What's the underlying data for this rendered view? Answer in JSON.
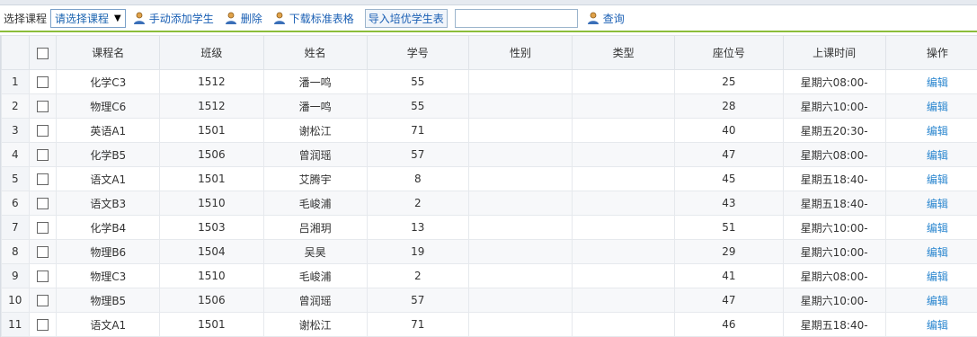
{
  "toolbar": {
    "course_label": "选择课程",
    "course_select_value": "请选择课程",
    "add_student": "手动添加学生",
    "delete": "删除",
    "download_template": "下载标准表格",
    "import_excellent": "导入培优学生表",
    "search_value": "",
    "query": "查询"
  },
  "table": {
    "headers": [
      "课程名",
      "班级",
      "姓名",
      "学号",
      "性别",
      "类型",
      "座位号",
      "上课时间",
      "操作"
    ],
    "edit_label": "编辑",
    "rows": [
      {
        "n": "1",
        "course": "化学C3",
        "class": "1512",
        "name": "潘一鸣",
        "sid": "55",
        "gender": "",
        "type": "",
        "seat": "25",
        "time": "星期六08:00-"
      },
      {
        "n": "2",
        "course": "物理C6",
        "class": "1512",
        "name": "潘一鸣",
        "sid": "55",
        "gender": "",
        "type": "",
        "seat": "28",
        "time": "星期六10:00-"
      },
      {
        "n": "3",
        "course": "英语A1",
        "class": "1501",
        "name": "谢松江",
        "sid": "71",
        "gender": "",
        "type": "",
        "seat": "40",
        "time": "星期五20:30-"
      },
      {
        "n": "4",
        "course": "化学B5",
        "class": "1506",
        "name": "曾润瑶",
        "sid": "57",
        "gender": "",
        "type": "",
        "seat": "47",
        "time": "星期六08:00-"
      },
      {
        "n": "5",
        "course": "语文A1",
        "class": "1501",
        "name": "艾腾宇",
        "sid": "8",
        "gender": "",
        "type": "",
        "seat": "45",
        "time": "星期五18:40-"
      },
      {
        "n": "6",
        "course": "语文B3",
        "class": "1510",
        "name": "毛峻浦",
        "sid": "2",
        "gender": "",
        "type": "",
        "seat": "43",
        "time": "星期五18:40-"
      },
      {
        "n": "7",
        "course": "化学B4",
        "class": "1503",
        "name": "吕湘玥",
        "sid": "13",
        "gender": "",
        "type": "",
        "seat": "51",
        "time": "星期六10:00-"
      },
      {
        "n": "8",
        "course": "物理B6",
        "class": "1504",
        "name": "吴昊",
        "sid": "19",
        "gender": "",
        "type": "",
        "seat": "29",
        "time": "星期六10:00-"
      },
      {
        "n": "9",
        "course": "物理C3",
        "class": "1510",
        "name": "毛峻浦",
        "sid": "2",
        "gender": "",
        "type": "",
        "seat": "41",
        "time": "星期六08:00-"
      },
      {
        "n": "10",
        "course": "物理B5",
        "class": "1506",
        "name": "曾润瑶",
        "sid": "57",
        "gender": "",
        "type": "",
        "seat": "47",
        "time": "星期六10:00-"
      },
      {
        "n": "11",
        "course": "语文A1",
        "class": "1501",
        "name": "谢松江",
        "sid": "71",
        "gender": "",
        "type": "",
        "seat": "46",
        "time": "星期五18:40-"
      }
    ]
  }
}
